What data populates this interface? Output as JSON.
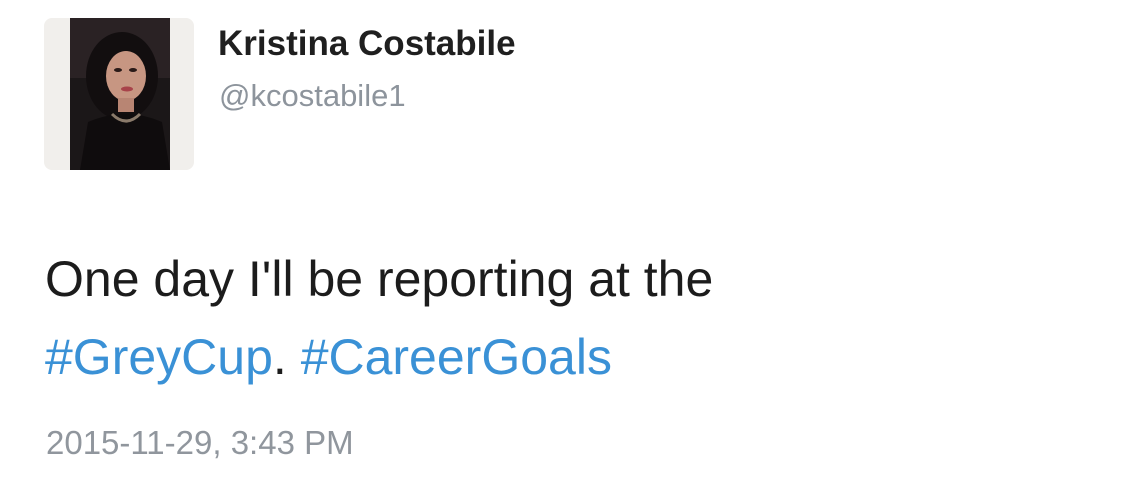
{
  "tweet": {
    "author": {
      "display_name": "Kristina Costabile",
      "handle": "@kcostabile1"
    },
    "text": {
      "line1": "One day I'll be reporting at the",
      "hashtag1": "#GreyCup",
      "separator": ". ",
      "hashtag2": "#CareerGoals"
    },
    "timestamp": "2015-11-29, 3:43 PM"
  },
  "colors": {
    "hashtag": "#3a91d6",
    "name": "#1f1f1f",
    "secondary_text": "#8d949c",
    "body_text": "#1c1c1c"
  }
}
